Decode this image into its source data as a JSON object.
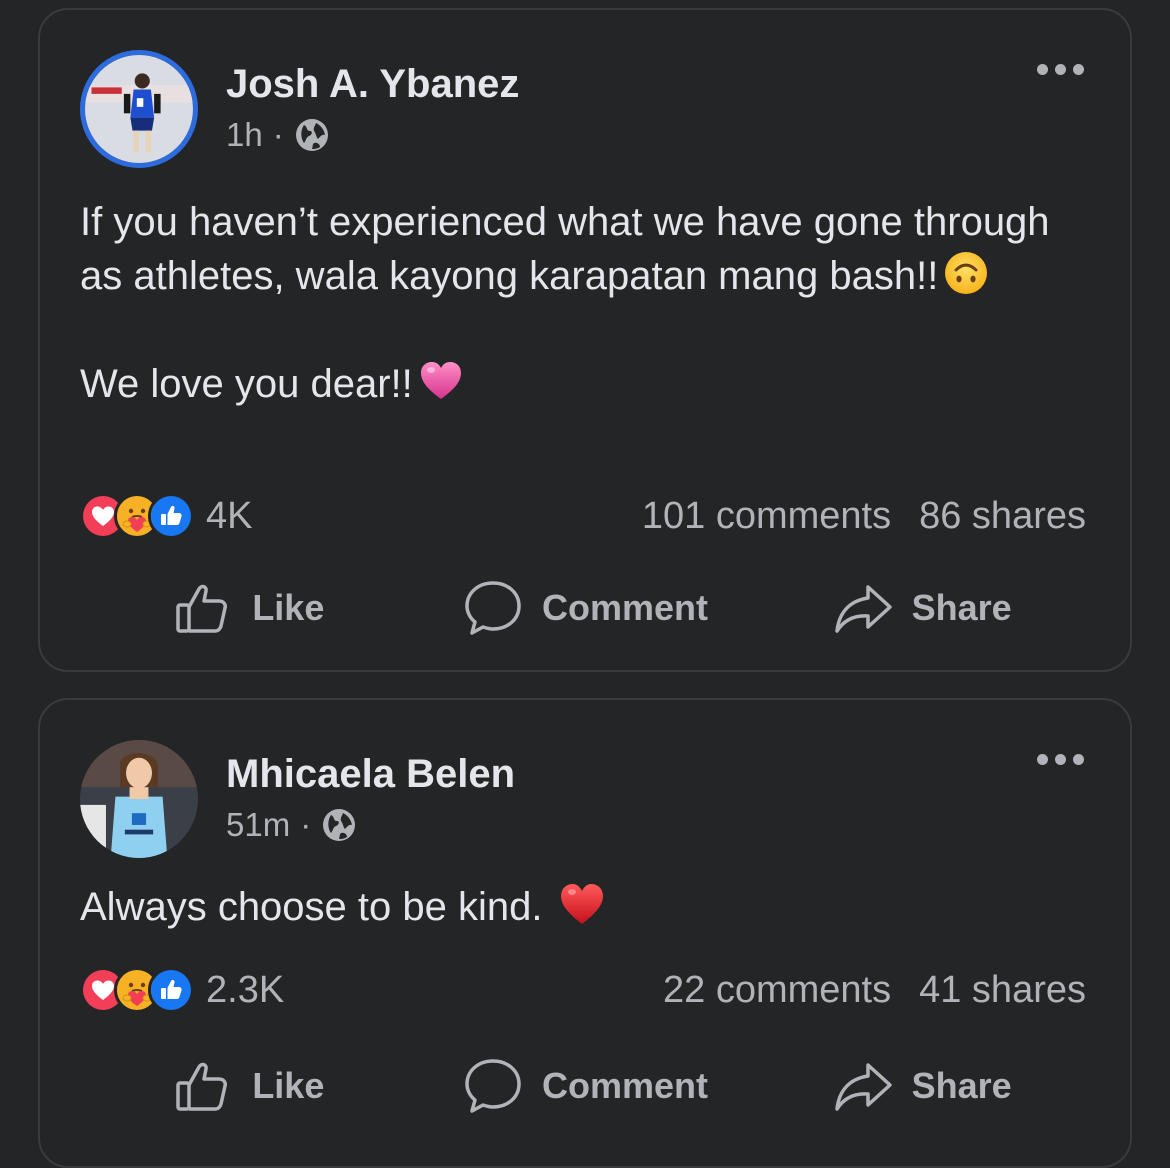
{
  "posts": [
    {
      "author": "Josh A. Ybanez",
      "time": "1h",
      "separator": "·",
      "privacy_icon": "globe-icon",
      "avatar_ring_color": "#2d6cdf",
      "text_paragraphs": [
        "If you haven’t experienced what we have gone through as athletes, wala kayong karapatan mang bash!!",
        "We love you dear!!"
      ],
      "emojis": [
        "upside-down-face-emoji",
        "pink-heart-emoji"
      ],
      "reactions": [
        "love-reaction",
        "care-reaction",
        "like-reaction"
      ],
      "reaction_count": "4K",
      "comments": "101 comments",
      "shares": "86 shares",
      "actions": {
        "like": "Like",
        "comment": "Comment",
        "share": "Share"
      }
    },
    {
      "author": "Mhicaela Belen",
      "time": "51m",
      "separator": "·",
      "privacy_icon": "globe-icon",
      "text_paragraphs": [
        "Always choose to be kind."
      ],
      "emojis": [
        "red-heart-emoji"
      ],
      "reactions": [
        "love-reaction",
        "care-reaction",
        "like-reaction"
      ],
      "reaction_count": "2.3K",
      "comments": "22 comments",
      "shares": "41 shares",
      "actions": {
        "like": "Like",
        "comment": "Comment",
        "share": "Share"
      }
    }
  ],
  "colors": {
    "background": "#242526",
    "text_primary": "#e4e6eb",
    "text_secondary": "#b0b3b8",
    "like_blue": "#1877f2",
    "love_red": "#f33e58"
  }
}
